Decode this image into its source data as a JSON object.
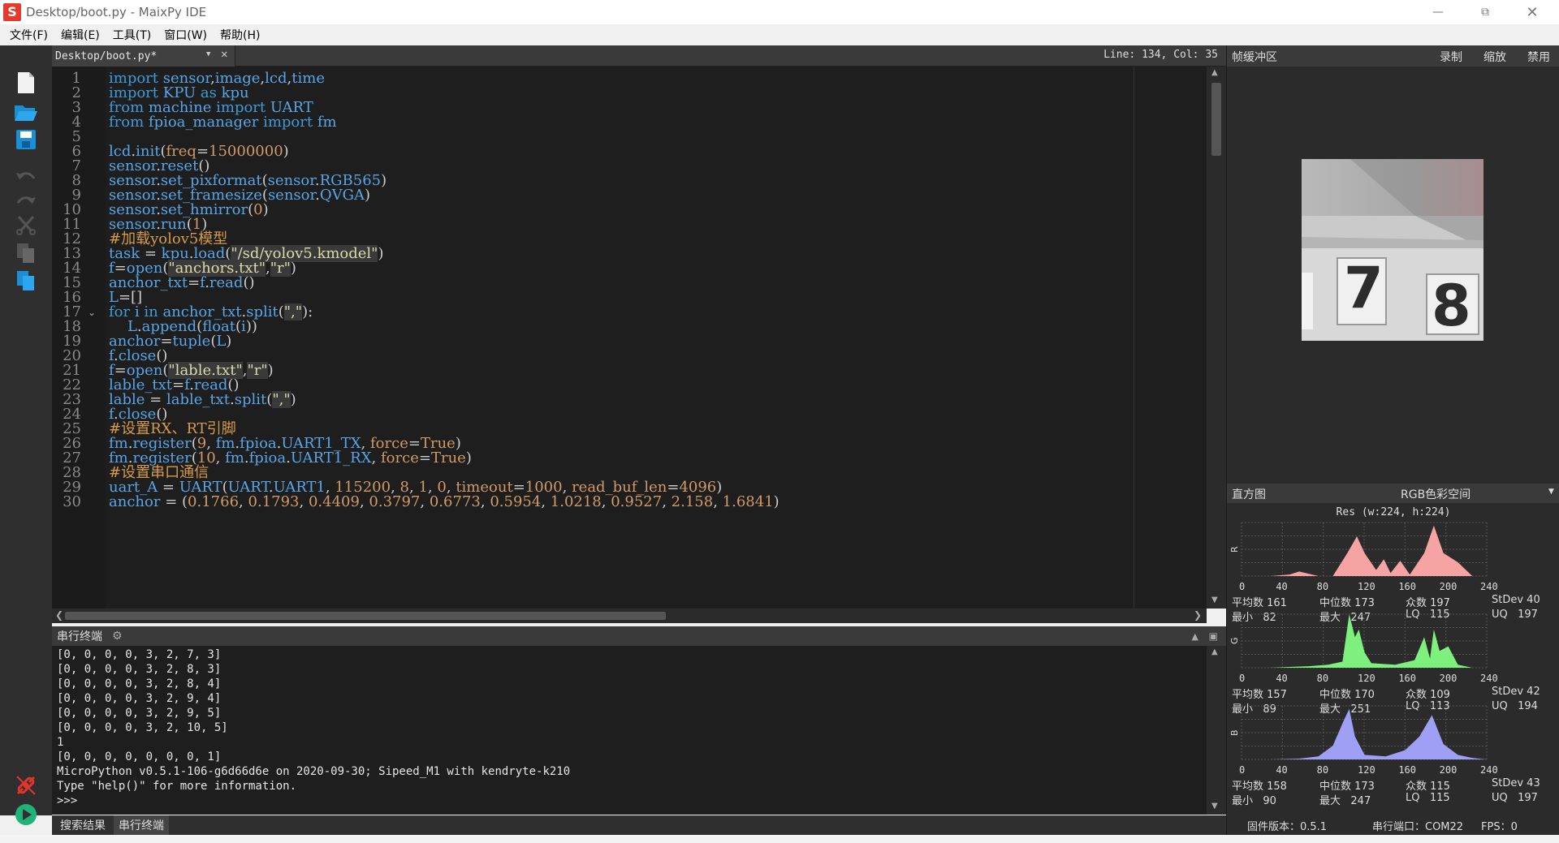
{
  "window": {
    "title": "Desktop/boot.py - MaixPy IDE",
    "logo": "S"
  },
  "menu": [
    {
      "label": "文件(F)"
    },
    {
      "label": "编辑(E)"
    },
    {
      "label": "工具(T)"
    },
    {
      "label": "窗口(W)"
    },
    {
      "label": "帮助(H)"
    }
  ],
  "editor": {
    "tab_label": "Desktop/boot.py*",
    "cursor": "Line: 134, Col: 35"
  },
  "code_lines": [
    "import sensor,image,lcd,time",
    "import KPU as kpu",
    "from machine import UART",
    "from fpioa_manager import fm",
    "",
    "lcd.init(freq=15000000)",
    "sensor.reset()",
    "sensor.set_pixformat(sensor.RGB565)",
    "sensor.set_framesize(sensor.QVGA)",
    "sensor.set_hmirror(0)",
    "sensor.run(1)",
    "#加载yolov5模型",
    "task = kpu.load(\"/sd/yolov5.kmodel\")",
    "f=open(\"anchors.txt\",\"r\")",
    "anchor_txt=f.read()",
    "L=[]",
    "for i in anchor_txt.split(\",\"):",
    "    L.append(float(i))",
    "anchor=tuple(L)",
    "f.close()",
    "f=open(\"lable.txt\",\"r\")",
    "lable_txt=f.read()",
    "lable = lable_txt.split(\",\")",
    "f.close()",
    "#设置RX、RT引脚",
    "fm.register(9, fm.fpioa.UART1_TX, force=True)",
    "fm.register(10, fm.fpioa.UART1_RX, force=True)",
    "#设置串口通信",
    "uart_A = UART(UART.UART1, 115200, 8, 1, 0, timeout=1000, read_buf_len=4096)",
    "anchor = (0.1766, 0.1793, 0.4409, 0.3797, 0.6773, 0.5954, 1.0218, 0.9527, 2.158, 1.6841)"
  ],
  "terminal": {
    "title": "串行终端",
    "lines": [
      "[0, 0, 0, 0, 3, 2, 7, 3]",
      "[0, 0, 0, 0, 3, 2, 8, 3]",
      "[0, 0, 0, 0, 3, 2, 8, 4]",
      "[0, 0, 0, 0, 3, 2, 9, 4]",
      "[0, 0, 0, 0, 3, 2, 9, 5]",
      "[0, 0, 0, 0, 3, 2, 10, 5]",
      "1",
      "[0, 0, 0, 0, 0, 0, 0, 1]",
      "MicroPython v0.5.1-106-g6d66d6e on 2020-09-30; Sipeed_M1 with kendryte-k210",
      "Type \"help()\" for more information.",
      ">>>"
    ]
  },
  "bottom_tabs": [
    {
      "label": "搜索结果"
    },
    {
      "label": "串行终端"
    }
  ],
  "framebuffer": {
    "title": "帧缓冲区",
    "actions": [
      {
        "label": "录制"
      },
      {
        "label": "缩放"
      },
      {
        "label": "禁用"
      }
    ],
    "digits": [
      "7",
      "8"
    ]
  },
  "histogram": {
    "title": "直方图",
    "colorspace": "RGB色彩空间",
    "res": "Res (w:224, h:224)",
    "x_ticks": [
      "0",
      "40",
      "80",
      "120",
      "160",
      "200",
      "240"
    ],
    "channels": [
      {
        "label": "R",
        "color": "#f5a3a3",
        "mean": "161",
        "median": "173",
        "mode": "197",
        "stdev": "40",
        "min": "82",
        "max": "247",
        "lq": "115",
        "uq": "197"
      },
      {
        "label": "G",
        "color": "#7ef07e",
        "mean": "157",
        "median": "170",
        "mode": "109",
        "stdev": "42",
        "min": "89",
        "max": "251",
        "lq": "113",
        "uq": "194"
      },
      {
        "label": "B",
        "color": "#9f9ff5",
        "mean": "158",
        "median": "173",
        "mode": "115",
        "stdev": "43",
        "min": "90",
        "max": "247",
        "lq": "115",
        "uq": "197"
      }
    ],
    "stat_labels": {
      "mean": "平均数",
      "median": "中位数",
      "mode": "众数",
      "stdev": "StDev",
      "min": "最小",
      "max": "最大",
      "lq": "LQ",
      "uq": "UQ"
    }
  },
  "status": {
    "firmware": "固件版本：0.5.1",
    "port": "串行端口：COM22",
    "fps": "FPS：0"
  }
}
